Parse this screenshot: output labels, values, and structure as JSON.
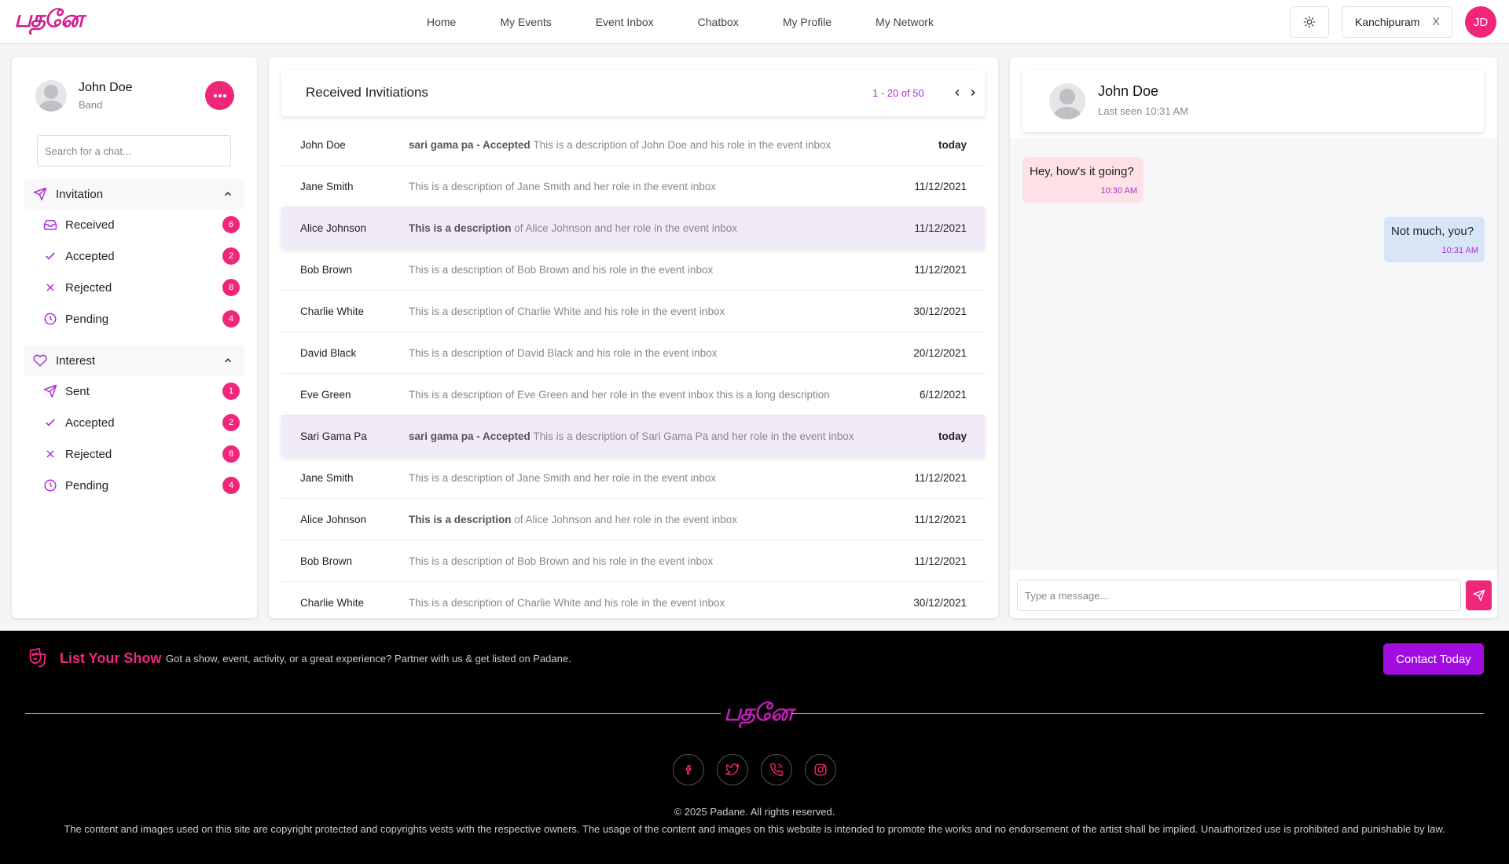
{
  "app": {
    "logo_text": "பதனே"
  },
  "nav": {
    "items": [
      "Home",
      "My Events",
      "Event Inbox",
      "Chatbox",
      "My Profile",
      "My Network"
    ]
  },
  "header": {
    "location": "Kanchipuram",
    "location_clear": "X",
    "user_initials": "JD"
  },
  "sidebar": {
    "profile": {
      "name": "John Doe",
      "role": "Band"
    },
    "search_placeholder": "Search for a chat...",
    "sections": [
      {
        "title": "Invitation",
        "icon": "send-icon",
        "items": [
          {
            "label": "Received",
            "icon": "inbox-icon",
            "count": "6"
          },
          {
            "label": "Accepted",
            "icon": "check-icon",
            "count": "2"
          },
          {
            "label": "Rejected",
            "icon": "x-icon",
            "count": "8"
          },
          {
            "label": "Pending",
            "icon": "clock-icon",
            "count": "4"
          }
        ]
      },
      {
        "title": "Interest",
        "icon": "heart-icon",
        "items": [
          {
            "label": "Sent",
            "icon": "send-icon",
            "count": "1"
          },
          {
            "label": "Accepted",
            "icon": "check-icon",
            "count": "2"
          },
          {
            "label": "Rejected",
            "icon": "x-icon",
            "count": "8"
          },
          {
            "label": "Pending",
            "icon": "clock-icon",
            "count": "4"
          }
        ]
      }
    ]
  },
  "inbox": {
    "title": "Received Invitiations",
    "pager": "1 - 20 of 50",
    "rows": [
      {
        "name": "John Doe",
        "bold": "sari gama pa - Accepted",
        "desc": " This is a description of John Doe and his role in the event inbox",
        "date": "today",
        "date_bold": true,
        "highlight": false
      },
      {
        "name": "Jane Smith",
        "bold": "",
        "desc": "This is a description of Jane Smith and her role in the event inbox",
        "date": "11/12/2021",
        "date_bold": false,
        "highlight": false
      },
      {
        "name": "Alice Johnson",
        "bold": "This is a description",
        "desc": " of Alice Johnson and her role in the event inbox",
        "date": "11/12/2021",
        "date_bold": false,
        "highlight": true
      },
      {
        "name": "Bob Brown",
        "bold": "",
        "desc": "This is a description of Bob Brown and his role in the event inbox",
        "date": "11/12/2021",
        "date_bold": false,
        "highlight": false
      },
      {
        "name": "Charlie White",
        "bold": "",
        "desc": "This is a description of Charlie White and his role in the event inbox",
        "date": "30/12/2021",
        "date_bold": false,
        "highlight": false
      },
      {
        "name": "David Black",
        "bold": "",
        "desc": "This is a description of David Black and his role in the event inbox",
        "date": "20/12/2021",
        "date_bold": false,
        "highlight": false
      },
      {
        "name": "Eve Green",
        "bold": "",
        "desc": "This is a description of Eve Green and her role in the event inbox this is a long description",
        "date": "6/12/2021",
        "date_bold": false,
        "highlight": false
      },
      {
        "name": "Sari Gama Pa",
        "bold": "sari gama pa - Accepted",
        "desc": " This is a description of Sari Gama Pa and her role in the event inbox",
        "date": "today",
        "date_bold": true,
        "highlight": true
      },
      {
        "name": "Jane Smith",
        "bold": "",
        "desc": "This is a description of Jane Smith and her role in the event inbox",
        "date": "11/12/2021",
        "date_bold": false,
        "highlight": false
      },
      {
        "name": "Alice Johnson",
        "bold": "This is a description",
        "desc": " of Alice Johnson and her role in the event inbox",
        "date": "11/12/2021",
        "date_bold": false,
        "highlight": false
      },
      {
        "name": "Bob Brown",
        "bold": "",
        "desc": "This is a description of Bob Brown and his role in the event inbox",
        "date": "11/12/2021",
        "date_bold": false,
        "highlight": false
      },
      {
        "name": "Charlie White",
        "bold": "",
        "desc": "This is a description of Charlie White and his role in the event inbox",
        "date": "30/12/2021",
        "date_bold": false,
        "highlight": false
      }
    ]
  },
  "chat": {
    "name": "John Doe",
    "last_seen": "Last seen 10:31 AM",
    "messages": [
      {
        "text": "Hey, how's it going?",
        "time": "10:30 AM",
        "direction": "in"
      },
      {
        "text": "Not much, you?",
        "time": "10:31 AM",
        "direction": "out"
      }
    ],
    "input_placeholder": "Type a message..."
  },
  "footer": {
    "list_title": "List Your Show",
    "list_text": "Got a show, event, activity, or a great experience? Partner with us & get listed on Padane.",
    "contact_label": "Contact Today",
    "logo_text": "பதனே",
    "social": [
      "facebook-icon",
      "twitter-icon",
      "phone-icon",
      "instagram-icon"
    ],
    "copyright": "© 2025 Padane. All rights reserved.",
    "legal": "The content and images used on this site are copyright protected and copyrights vests with the respective owners. The usage of the content and images on this website is intended to promote the works and no endorsement of the artist shall be implied. Unauthorized use is prohibited and punishable by law."
  },
  "colors": {
    "accent": "#f0267a",
    "purple": "#a10ce0",
    "highlight_row": "#f1eaf8",
    "incoming_bubble": "#fde1e6",
    "outgoing_bubble": "#d8e5f7"
  }
}
